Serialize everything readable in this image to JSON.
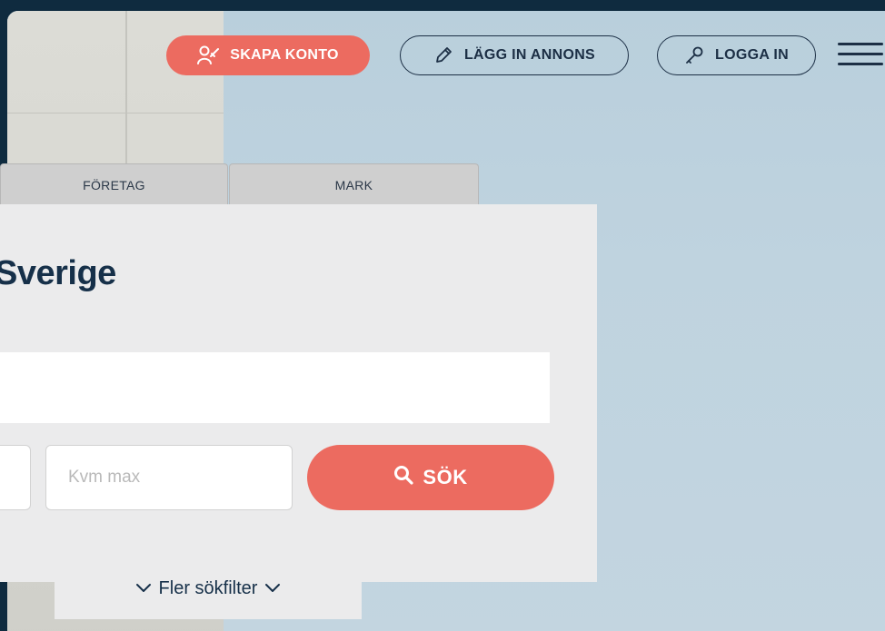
{
  "header": {
    "create_account": "SKAPA KONTO",
    "post_listing": "LÄGG IN ANNONS",
    "login": "LOGGA IN"
  },
  "tabs": [
    {
      "label": "FÖRETAG"
    },
    {
      "label": "MARK"
    }
  ],
  "search": {
    "title": "Sverige",
    "location_value": "",
    "kvm_max_placeholder": "Kvm max",
    "search_label": "SÖK",
    "more_filters": "Fler sökfilter"
  },
  "colors": {
    "accent": "#ec6b60",
    "navy": "#1c2f45",
    "panel": "#ebebec"
  },
  "icons": {
    "create_account": "user-plus-icon",
    "post_listing": "pencil-icon",
    "login": "key-icon",
    "menu": "hamburger-icon",
    "search": "search-icon",
    "chevrons": "chevron-down-icon"
  }
}
